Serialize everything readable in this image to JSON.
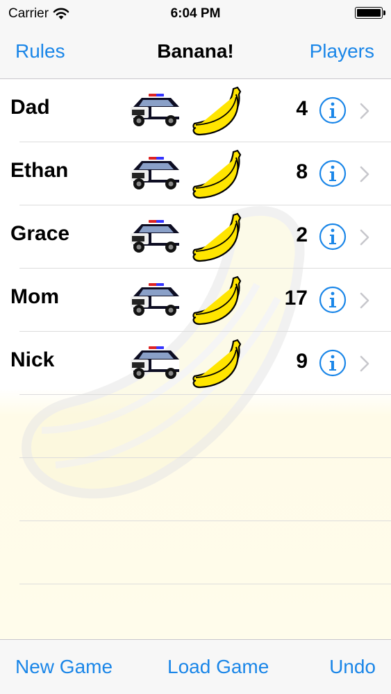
{
  "status_bar": {
    "carrier": "Carrier",
    "time": "6:04 PM"
  },
  "nav": {
    "left_button": "Rules",
    "title": "Banana!",
    "right_button": "Players"
  },
  "players": [
    {
      "name": "Dad",
      "score": "4"
    },
    {
      "name": "Ethan",
      "score": "8"
    },
    {
      "name": "Grace",
      "score": "2"
    },
    {
      "name": "Mom",
      "score": "17"
    },
    {
      "name": "Nick",
      "score": "9"
    }
  ],
  "row_icons": [
    "police-car-icon",
    "banana-icon",
    "info-icon",
    "chevron-right-icon"
  ],
  "toolbar": {
    "new_game": "New Game",
    "load_game": "Load Game",
    "undo": "Undo"
  },
  "colors": {
    "accent": "#1a86e8",
    "banana": "#ffe500",
    "background_tint": "#fffcec"
  }
}
